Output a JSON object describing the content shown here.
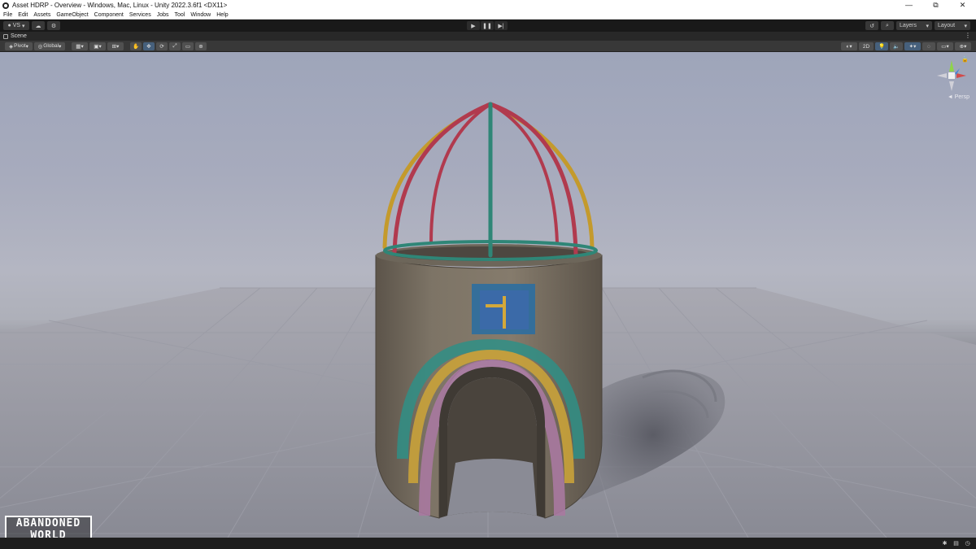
{
  "window": {
    "title": "Asset HDRP - Overview - Windows, Mac, Linux - Unity 2022.3.6f1 <DX11>",
    "controls": [
      "—",
      "⧉",
      "✕"
    ]
  },
  "menu": [
    "File",
    "Edit",
    "Assets",
    "GameObject",
    "Component",
    "Services",
    "Jobs",
    "Tool",
    "Window",
    "Help"
  ],
  "toolbar": {
    "account_label": "VS",
    "cloud_icon": "cloud-icon",
    "collab_icon": "gear-icon",
    "play_icons": [
      "play-icon",
      "pause-icon",
      "step-icon"
    ],
    "history_icon": "history-icon",
    "search_icon": "search-icon",
    "layers_label": "Layers",
    "layout_label": "Layout"
  },
  "scene_tab": {
    "label": "Scene"
  },
  "scene_toolbar": {
    "pivot_label": "Pivot",
    "global_label": "Global",
    "mode_2d_label": "2D"
  },
  "gizmo": {
    "persp_label": "◄ Persp"
  },
  "watermark": {
    "line1": "ABANDONED",
    "line2": "WORLD"
  },
  "colors": {
    "title_bar": "#ffffff",
    "toolbar_bg": "#191919",
    "scene_toolbar_bg": "#383838",
    "viewport_sky": "#a7abbd",
    "ground": "#8e8f99",
    "tower_stone": "#7a7060",
    "rainbow_teal": "#2f8f86",
    "rainbow_yellow": "#c9a23a",
    "rainbow_pink": "#a879a0",
    "window_blue": "#3b6aa8",
    "cage_red": "#b13a4e",
    "cage_yellow": "#c49a2c",
    "cage_teal": "#2f8677"
  }
}
